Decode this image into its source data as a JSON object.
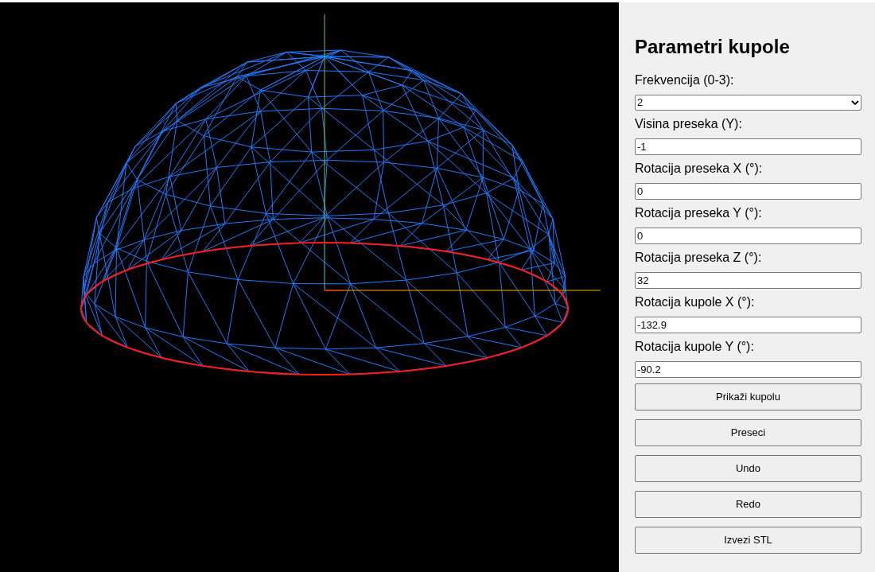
{
  "panel": {
    "title": "Parametri kupole",
    "fields": [
      {
        "kind": "select",
        "label": "Frekvencija (0-3):",
        "value": "2"
      },
      {
        "kind": "input",
        "label": "Visina preseka (Y):",
        "value": "-1"
      },
      {
        "kind": "input",
        "label": "Rotacija preseka X (°):",
        "value": "0"
      },
      {
        "kind": "input",
        "label": "Rotacija preseka Y (°):",
        "value": "0"
      },
      {
        "kind": "input",
        "label": "Rotacija preseka Z (°):",
        "value": "32"
      },
      {
        "kind": "input",
        "label": "Rotacija kupole X (°):",
        "value": "-132.9"
      },
      {
        "kind": "input",
        "label": "Rotacija kupole Y (°):",
        "value": "-90.2"
      }
    ],
    "buttons": [
      "Prikaži kupolu",
      "Preseci",
      "Undo",
      "Redo",
      "Izvezi STL"
    ]
  }
}
